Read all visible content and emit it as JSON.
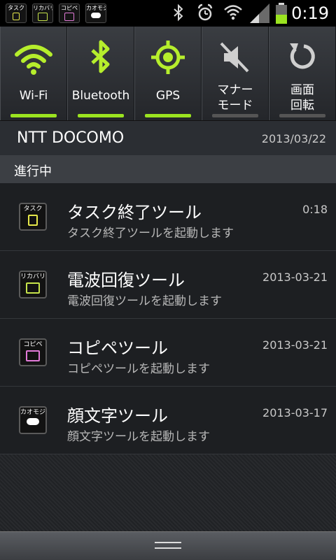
{
  "status_bar": {
    "time": "0:19",
    "apps": [
      {
        "tag": "タスク",
        "color": "#e6e84a"
      },
      {
        "tag": "リカバリ",
        "color": "#c6e34a"
      },
      {
        "tag": "コピペ",
        "color": "#e27ad8"
      },
      {
        "tag": "カオモジ",
        "color": "#ffffff"
      }
    ],
    "icons": [
      "bluetooth-icon",
      "alarm-icon",
      "wifi-icon",
      "signal-icon",
      "battery-icon"
    ],
    "accent": "#9be320"
  },
  "toggles": [
    {
      "label": "Wi-Fi",
      "icon": "wifi-icon",
      "active": true
    },
    {
      "label": "Bluetooth",
      "icon": "bluetooth-icon",
      "active": true
    },
    {
      "label": "GPS",
      "icon": "gps-icon",
      "active": true
    },
    {
      "label_line1": "マナー",
      "label_line2": "モード",
      "icon": "silent-mode-icon",
      "active": false
    },
    {
      "label_line1": "画面",
      "label_line2": "回転",
      "icon": "rotate-icon",
      "active": false
    }
  ],
  "carrier": {
    "name": "NTT DOCOMO",
    "date": "2013/03/22"
  },
  "section": {
    "title": "進行中"
  },
  "notifications": [
    {
      "tag": "タスク",
      "title": "タスク終了ツール",
      "subtitle": "タスク終了ツールを起動します",
      "time": "0:18",
      "color": "#e6e84a"
    },
    {
      "tag": "リカバリ",
      "title": "電波回復ツール",
      "subtitle": "電波回復ツールを起動します",
      "time": "2013-03-21",
      "color": "#c6e34a"
    },
    {
      "tag": "コピペ",
      "title": "コピペツール",
      "subtitle": "コピペツールを起動します",
      "time": "2013-03-21",
      "color": "#e27ad8"
    },
    {
      "tag": "カオモジ",
      "title": "顔文字ツール",
      "subtitle": "顔文字ツールを起動します",
      "time": "2013-03-17",
      "color": "#ffffff"
    }
  ]
}
